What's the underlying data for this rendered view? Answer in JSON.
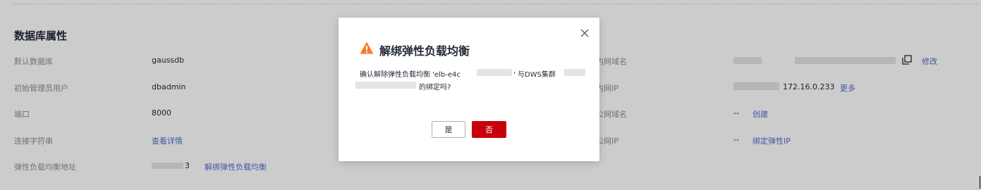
{
  "section": {
    "title": "数据库属性"
  },
  "left_props": [
    {
      "label": "默认数据库",
      "value": "gaussdb"
    },
    {
      "label": "初始管理员用户",
      "value": "dbadmin"
    },
    {
      "label": "端口",
      "value": "8000"
    },
    {
      "label": "连接字符串",
      "link": "查看详情"
    },
    {
      "label": "弹性负载均衡地址",
      "value_tail": "3",
      "link": "解绑弹性负载均衡"
    }
  ],
  "right_props": [
    {
      "label": "内网域名",
      "link": "修改",
      "icon": "copy-icon"
    },
    {
      "label": "内网IP",
      "value": "172.16.0.233",
      "link": "更多"
    },
    {
      "label": "公网域名",
      "value": "--",
      "link": "创建"
    },
    {
      "label": "公网IP",
      "value": "--",
      "link": "绑定弹性IP"
    }
  ],
  "dialog": {
    "title": "解绑弹性负载均衡",
    "icon": "warning-icon",
    "msg_part1": "确认解除弹性负载均衡 'elb-e4c",
    "msg_part2": "' 与DWS集群",
    "msg_part3": "的绑定吗?",
    "yes_label": "是",
    "no_label": "否",
    "close_icon": "close-icon"
  },
  "colors": {
    "link": "#526ecc",
    "danger": "#c7000b",
    "warning": "#fa7b26",
    "text": "#252b3a",
    "label": "#8a8e99"
  }
}
